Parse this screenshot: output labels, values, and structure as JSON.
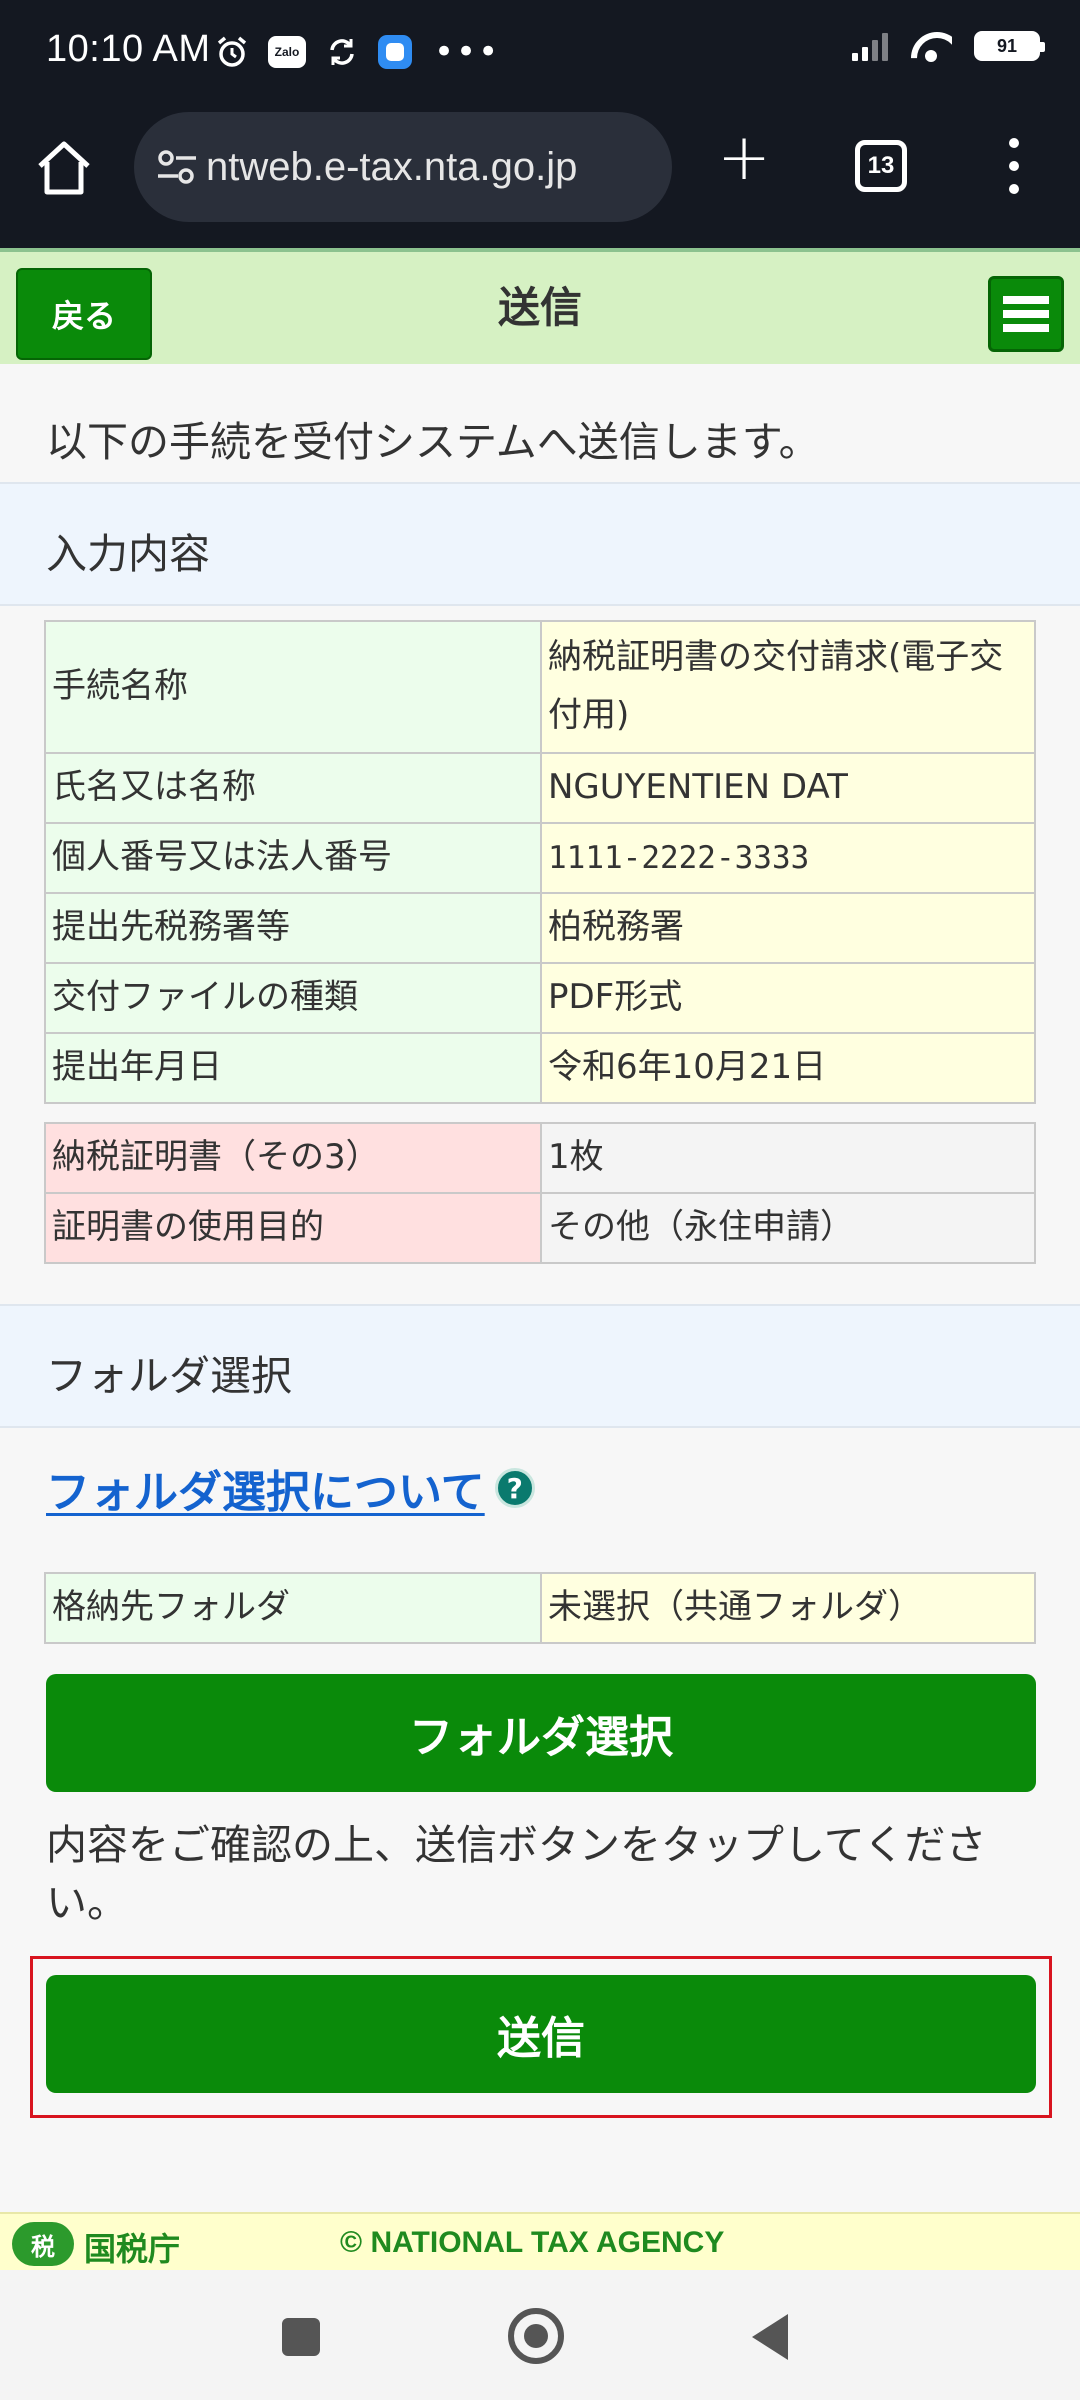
{
  "status_bar": {
    "time": "10:10 AM",
    "zalo_label": "Zalo",
    "battery": "91",
    "more": "•••"
  },
  "browser": {
    "url": "ntweb.e-tax.nta.go.jp",
    "tab_count": "13"
  },
  "header": {
    "back_label": "戻る",
    "title": "送信"
  },
  "intro": "以下の手続を受付システムへ送信します。",
  "input_section": {
    "title": "入力内容",
    "rows": [
      {
        "label": "手続名称",
        "value": "納税証明書の交付請求(電子交付用)"
      },
      {
        "label": "氏名又は名称",
        "value": "NGUYENTIEN DAT"
      },
      {
        "label": "個人番号又は法人番号",
        "value": "1111-2222-3333"
      },
      {
        "label": "提出先税務署等",
        "value": "柏税務署"
      },
      {
        "label": "交付ファイルの種類",
        "value": "PDF形式"
      },
      {
        "label": "提出年月日",
        "value": "令和6年10月21日"
      }
    ],
    "cert_rows": [
      {
        "label": "納税証明書（その3）",
        "value": "1枚"
      },
      {
        "label": "証明書の使用目的",
        "value": "その他（永住申請）"
      }
    ]
  },
  "folder_section": {
    "title": "フォルダ選択",
    "link_label": "フォルダ選択について",
    "help_glyph": "?",
    "row": {
      "label": "格納先フォルダ",
      "value": "未選択（共通フォルダ）"
    },
    "button_label": "フォルダ選択"
  },
  "confirm_text": "内容をご確認の上、送信ボタンをタップしてください。",
  "submit_label": "送信",
  "footer": {
    "logo_text": "税",
    "agency": "国税庁",
    "copyright": "© NATIONAL TAX AGENCY"
  },
  "colors": {
    "accent_green": "#0a8a0a",
    "header_bg": "#d6f1c3",
    "highlight_red": "#d8141f",
    "link_blue": "#1463cf"
  }
}
